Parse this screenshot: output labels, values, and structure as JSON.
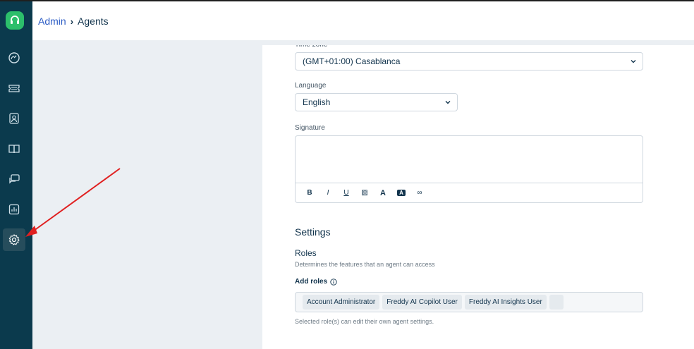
{
  "header": {
    "breadcrumb_parent": "Admin",
    "breadcrumb_current": "Agents"
  },
  "sidebar": {
    "items": [
      {
        "name": "dashboard",
        "icon": "gauge-icon"
      },
      {
        "name": "tickets",
        "icon": "ticket-icon"
      },
      {
        "name": "contacts",
        "icon": "contact-icon"
      },
      {
        "name": "solutions",
        "icon": "book-icon"
      },
      {
        "name": "forums",
        "icon": "chat-icon"
      },
      {
        "name": "analytics",
        "icon": "chart-icon"
      },
      {
        "name": "admin",
        "icon": "gear-icon",
        "active": true
      }
    ]
  },
  "form": {
    "timezone_label": "Time zone",
    "timezone_value": "(GMT+01:00) Casablanca",
    "language_label": "Language",
    "language_value": "English",
    "signature_label": "Signature",
    "toolbar": [
      "B",
      "I",
      "U",
      "▨",
      "A",
      "A",
      "∞"
    ]
  },
  "settings": {
    "title": "Settings",
    "roles_title": "Roles",
    "roles_desc": "Determines the features that an agent can access",
    "add_roles_label": "Add roles",
    "roles": [
      "Account Administrator",
      "Freddy AI Copilot User",
      "Freddy AI Insights User"
    ],
    "helper": "Selected role(s) can edit their own agent settings."
  },
  "colors": {
    "sidebar": "#0b3a4d",
    "accent": "#2cbf6b",
    "link": "#2c5cc5",
    "annotation_arrow": "#e02020"
  }
}
